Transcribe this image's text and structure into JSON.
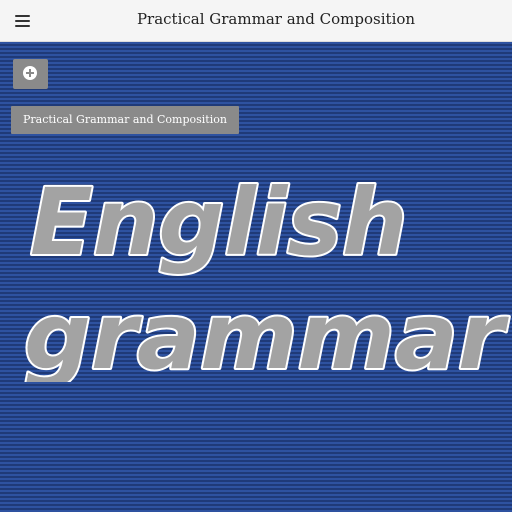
{
  "header": {
    "title": "Practical Grammar and Composition",
    "menu_icon": "hamburger-menu-icon"
  },
  "toolbar": {
    "add_icon": "add-circle-icon"
  },
  "book": {
    "chip_label": "Practical Grammar and Composition",
    "cover_line_1": "English",
    "cover_line_2": "grammar"
  },
  "colors": {
    "cover_background": "#2a4a8c",
    "cover_text_fill": "#a3a3a3",
    "cover_text_stroke": "#ffffff",
    "chip_background": "#8a8a8a",
    "topbar_background": "#f5f5f5"
  }
}
